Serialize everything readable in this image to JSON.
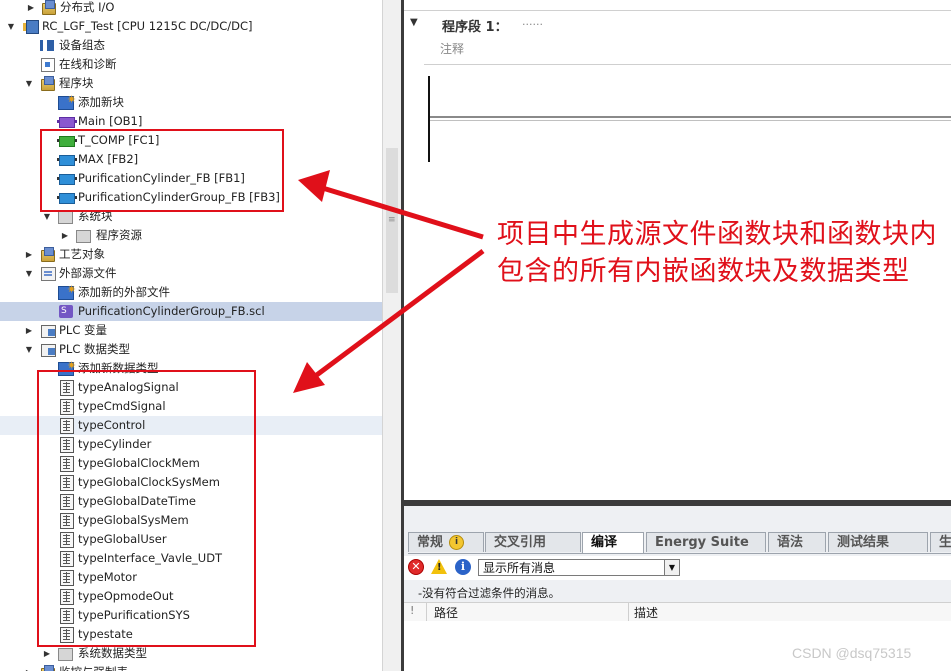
{
  "tree": {
    "rows": [
      {
        "label": "分布式 I/O",
        "icon": "folder-icon"
      },
      {
        "label": "RC_LGF_Test [CPU 1215C DC/DC/DC]",
        "icon": "cpu-icon"
      },
      {
        "label": "设备组态",
        "icon": "device-config-icon"
      },
      {
        "label": "在线和诊断",
        "icon": "online-diagnostics-icon"
      },
      {
        "label": "程序块",
        "icon": "folder-icon"
      },
      {
        "label": "添加新块",
        "icon": "add-new-icon"
      },
      {
        "label": "Main [OB1]",
        "icon": "ob-block-icon"
      },
      {
        "label": "T_COMP [FC1]",
        "icon": "fc-block-icon"
      },
      {
        "label": "MAX [FB2]",
        "icon": "fb-block-icon"
      },
      {
        "label": "PurificationCylinder_FB [FB1]",
        "icon": "fb-block-icon"
      },
      {
        "label": "PurificationCylinderGroup_FB [FB3]",
        "icon": "fb-block-icon"
      },
      {
        "label": "系统块",
        "icon": "system-block-icon"
      },
      {
        "label": "程序资源",
        "icon": "system-block-icon"
      },
      {
        "label": "工艺对象",
        "icon": "folder-icon"
      },
      {
        "label": "外部源文件",
        "icon": "folder-icon"
      },
      {
        "label": "添加新的外部文件",
        "icon": "add-new-icon"
      },
      {
        "label": "PurificationCylinderGroup_FB.scl",
        "icon": "scl-file-icon"
      },
      {
        "label": "PLC 变量",
        "icon": "folder-icon"
      },
      {
        "label": "PLC 数据类型",
        "icon": "folder-icon"
      },
      {
        "label": "添加新数据类型",
        "icon": "add-new-icon"
      },
      {
        "label": "typeAnalogSignal",
        "icon": "data-type-icon"
      },
      {
        "label": "typeCmdSignal",
        "icon": "data-type-icon"
      },
      {
        "label": "typeControl",
        "icon": "data-type-icon"
      },
      {
        "label": "typeCylinder",
        "icon": "data-type-icon"
      },
      {
        "label": "typeGlobalClockMem",
        "icon": "data-type-icon"
      },
      {
        "label": "typeGlobalClockSysMem",
        "icon": "data-type-icon"
      },
      {
        "label": "typeGlobalDateTime",
        "icon": "data-type-icon"
      },
      {
        "label": "typeGlobalSysMem",
        "icon": "data-type-icon"
      },
      {
        "label": "typeGlobalUser",
        "icon": "data-type-icon"
      },
      {
        "label": "typeInterface_Vavle_UDT",
        "icon": "data-type-icon"
      },
      {
        "label": "typeMotor",
        "icon": "data-type-icon"
      },
      {
        "label": "typeOpmodeOut",
        "icon": "data-type-icon"
      },
      {
        "label": "typePurificationSYS",
        "icon": "data-type-icon"
      },
      {
        "label": "typestate",
        "icon": "data-type-icon"
      },
      {
        "label": "系统数据类型",
        "icon": "system-block-icon"
      },
      {
        "label": "监控与强制表",
        "icon": "folder-icon"
      }
    ]
  },
  "editor": {
    "segment_title": "程序段 1：",
    "segment_dots": "......",
    "comment_label": "注释"
  },
  "panel": {
    "tabs": [
      {
        "label": "常规",
        "has_info": true
      },
      {
        "label": "交叉引用",
        "has_info": false
      },
      {
        "label": "编译",
        "has_info": false,
        "active": true
      },
      {
        "label": "Energy Suite",
        "has_info": false
      },
      {
        "label": "语法",
        "has_info": false
      },
      {
        "label": "测试结果",
        "has_info": false
      },
      {
        "label": "生",
        "has_info": false
      }
    ],
    "info_badge": "i",
    "filter_value": "显示所有消息",
    "message": "-没有符合过滤条件的消息。",
    "col_flag": "!",
    "col_path": "路径",
    "col_desc": "描述"
  },
  "annotation": {
    "text": "项目中生成源文件函数块和函数块内包含的所有内嵌函数块及数据类型",
    "color": "#e0101a"
  },
  "watermark": "CSDN @dsq75315"
}
